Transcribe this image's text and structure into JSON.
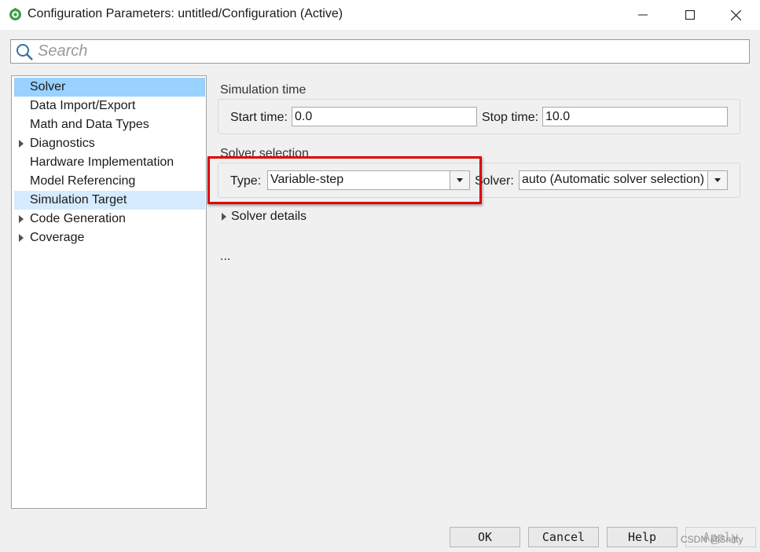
{
  "window": {
    "title": "Configuration Parameters: untitled/Configuration (Active)",
    "app_icon": "gear-icon"
  },
  "search": {
    "placeholder": "Search",
    "value": ""
  },
  "tree": {
    "items": [
      {
        "label": "Solver",
        "expandable": false,
        "state": "selected"
      },
      {
        "label": "Data Import/Export",
        "expandable": false,
        "state": ""
      },
      {
        "label": "Math and Data Types",
        "expandable": false,
        "state": ""
      },
      {
        "label": "Diagnostics",
        "expandable": true,
        "state": ""
      },
      {
        "label": "Hardware Implementation",
        "expandable": false,
        "state": ""
      },
      {
        "label": "Model Referencing",
        "expandable": false,
        "state": ""
      },
      {
        "label": "Simulation Target",
        "expandable": false,
        "state": "hover"
      },
      {
        "label": "Code Generation",
        "expandable": true,
        "state": ""
      },
      {
        "label": "Coverage",
        "expandable": true,
        "state": ""
      }
    ]
  },
  "simulation_time": {
    "title": "Simulation time",
    "start_label": "Start time:",
    "start_value": "0.0",
    "stop_label": "Stop time:",
    "stop_value": "10.0"
  },
  "solver_selection": {
    "title": "Solver selection",
    "type_label": "Type:",
    "type_value": "Variable-step",
    "solver_label": "Solver:",
    "solver_value": "auto (Automatic solver selection)"
  },
  "solver_details": {
    "label": "Solver details"
  },
  "ellipsis": "...",
  "buttons": {
    "ok": "OK",
    "cancel": "Cancel",
    "help": "Help",
    "apply": "Apply"
  },
  "watermark": "CSDN @Snitty",
  "colors": {
    "selected": "#99d1ff",
    "hover": "#d6ebfd",
    "highlight": "#e00000"
  }
}
